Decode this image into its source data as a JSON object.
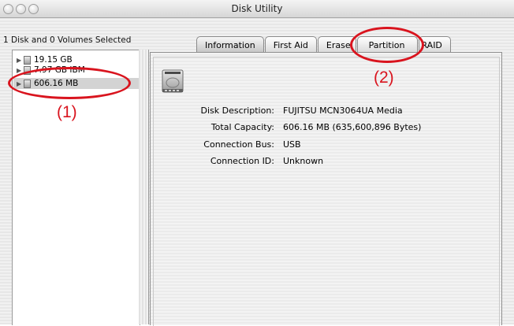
{
  "window": {
    "title": "Disk Utility"
  },
  "sidebar": {
    "header": "1 Disk and 0 Volumes Selected",
    "items": [
      {
        "label": "19.15 GB"
      },
      {
        "label": "7.97 GB IBM"
      },
      {
        "label": "606.16 MB"
      }
    ]
  },
  "tabs": [
    {
      "label": "Information"
    },
    {
      "label": "First Aid"
    },
    {
      "label": "Erase"
    },
    {
      "label": "Partition"
    },
    {
      "label": "RAID"
    }
  ],
  "info": {
    "disk_description": {
      "label": "Disk Description:",
      "value": "FUJITSU MCN3064UA Media"
    },
    "total_capacity": {
      "label": "Total Capacity:",
      "value": "606.16 MB (635,600,896 Bytes)"
    },
    "connection_bus": {
      "label": "Connection Bus:",
      "value": "USB"
    },
    "connection_id": {
      "label": "Connection ID:",
      "value": "Unknown"
    }
  },
  "annotations": [
    {
      "label": "(1)"
    },
    {
      "label": "(2)"
    }
  ],
  "colors": {
    "annotation": "#d9141e",
    "selection": "#d3d3d3"
  }
}
